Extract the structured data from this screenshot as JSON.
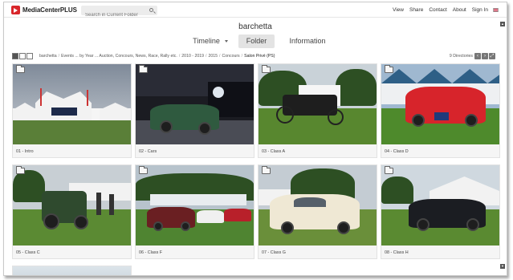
{
  "header": {
    "logo_text": "MediaCenterPLUS",
    "search_placeholder": "Search in Current Folder",
    "nav": [
      "View",
      "Share",
      "Contact",
      "About",
      "Sign In"
    ]
  },
  "folder": {
    "title": "barchetta"
  },
  "tabs": {
    "timeline": "Timeline",
    "folder": "Folder",
    "information": "Information"
  },
  "breadcrumb": {
    "items": [
      "barchetta",
      "Events ... by Year ... Auction, Concours, News, Race, Rally etc.",
      "2010 - 2019",
      "2015",
      "Concours"
    ],
    "current": "Salon Privé (PS)"
  },
  "directory_count": "9 Directories",
  "folders": [
    {
      "label": "01 - Intro",
      "scene": "tents"
    },
    {
      "label": "02 - Cars",
      "scene": "showroom"
    },
    {
      "label": "03 - Class A",
      "scene": "veteran"
    },
    {
      "label": "04 - Class D",
      "scene": "red-roadster"
    },
    {
      "label": "05 - Class C",
      "scene": "green-race"
    },
    {
      "label": "06 - Class F",
      "scene": "lineup"
    },
    {
      "label": "07 - Class G",
      "scene": "cream-coupe"
    },
    {
      "label": "08 - Class H",
      "scene": "black-coupe"
    }
  ],
  "colors": {
    "brand": "#d8262a",
    "active_tab": "#e3e3e3"
  }
}
